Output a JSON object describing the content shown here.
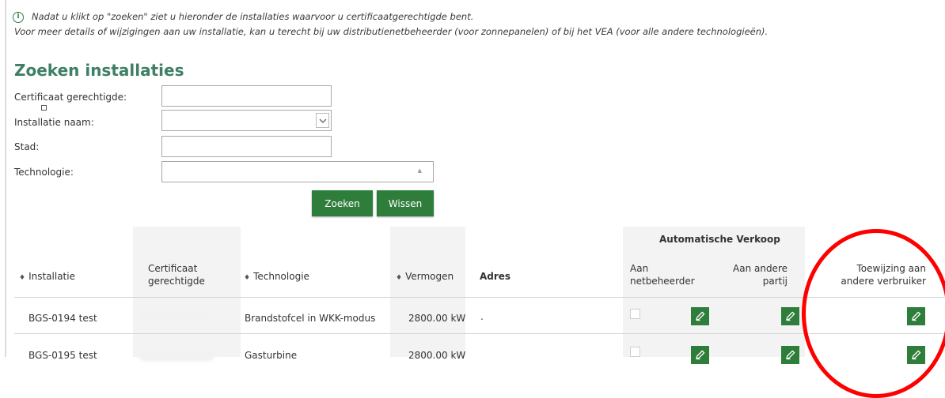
{
  "info": {
    "line1": "Nadat u klikt op \"zoeken\" ziet u hieronder de installaties waarvoor u certificaatgerechtigde bent.",
    "line2": "Voor meer details of wijzigingen aan uw installatie, kan u terecht bij uw distributienetbeheerder (voor zonnepanelen) of bij het VEA (voor alle andere technologieën).",
    "icon_glyph": "i"
  },
  "page_title": "Zoeken installaties",
  "form": {
    "certificaat_label": "Certificaat gerechtigde:",
    "installatie_label": "Installatie naam:",
    "stad_label": "Stad:",
    "technologie_label": "Technologie:",
    "certificaat_value": "",
    "installatie_value": "",
    "stad_value": "",
    "technologie_value": ""
  },
  "buttons": {
    "zoeken": "Zoeken",
    "wissen": "Wissen"
  },
  "table": {
    "group_header": "Automatische Verkoop",
    "headers": {
      "installatie": "Installatie",
      "certificaat1": "Certificaat",
      "certificaat2": "gerechtigde",
      "technologie": "Technologie",
      "vermogen": "Vermogen",
      "adres": "Adres",
      "netbeheerder1": "Aan",
      "netbeheerder2": "netbeheerder",
      "andere1": "Aan andere",
      "andere2": "partij",
      "toewijzing1": "Toewijzing aan",
      "toewijzing2": "andere verbruiker"
    },
    "rows": [
      {
        "installatie": "BGS-0194 test",
        "technologie": "Brandstofcel in WKK-modus",
        "vermogen": "2800.00 kW",
        "adres": "."
      },
      {
        "installatie": "BGS-0195 test",
        "technologie": "Gasturbine",
        "vermogen": "2800.00 kW",
        "adres": ""
      }
    ]
  },
  "icons": {
    "info": "info-circle-icon",
    "pencil": "pencil-icon",
    "select_arrow": "chevron-down-icon"
  },
  "colors": {
    "accent_green": "#2e7d3b",
    "title_green": "#3f7f66",
    "annotation_red": "#ff0000"
  }
}
